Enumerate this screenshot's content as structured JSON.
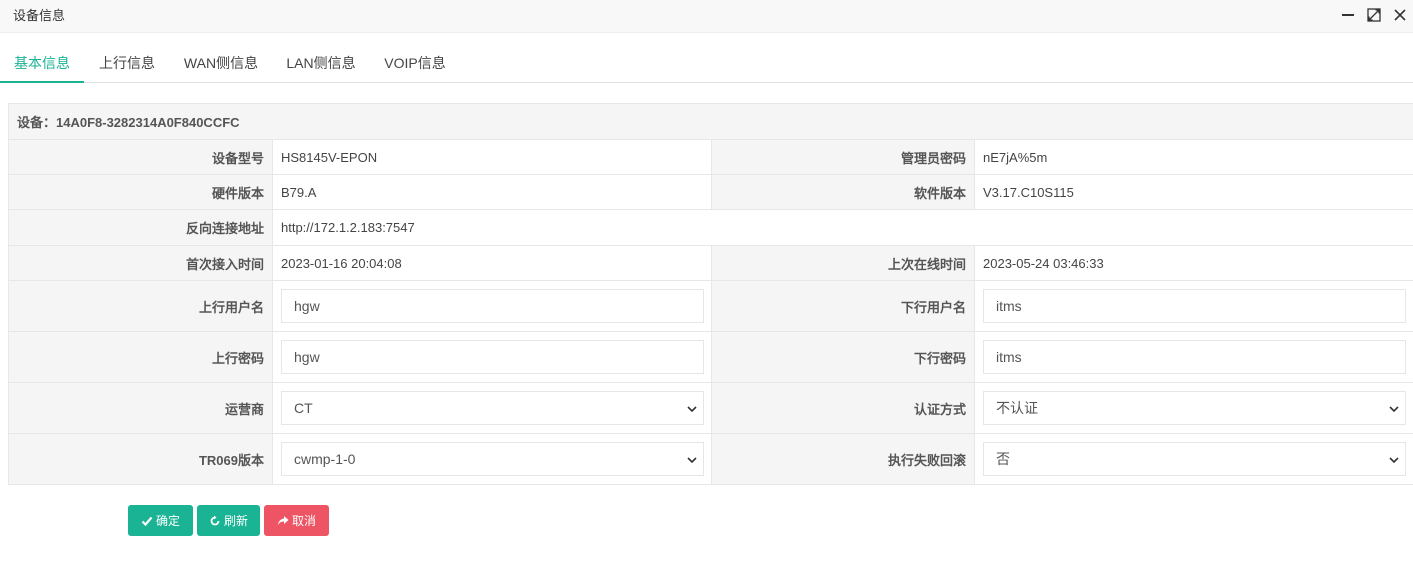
{
  "window": {
    "title": "设备信息"
  },
  "tabs": [
    {
      "label": "基本信息",
      "active": true
    },
    {
      "label": "上行信息"
    },
    {
      "label": "WAN侧信息"
    },
    {
      "label": "LAN侧信息"
    },
    {
      "label": "VOIP信息"
    }
  ],
  "device": {
    "header": "设备：14A0F8-3282314A0F840CCFC"
  },
  "fields": {
    "model_label": "设备型号",
    "model_value": "HS8145V-EPON",
    "admin_pwd_label": "管理员密码",
    "admin_pwd_value": "nE7jA%5m",
    "hw_label": "硬件版本",
    "hw_value": "B79.A",
    "sw_label": "软件版本",
    "sw_value": "V3.17.C10S115",
    "conn_url_label": "反向连接地址",
    "conn_url_value": "http://172.1.2.183:7547",
    "first_access_label": "首次接入时间",
    "first_access_value": "2023-01-16 20:04:08",
    "last_online_label": "上次在线时间",
    "last_online_value": "2023-05-24 03:46:33",
    "up_user_label": "上行用户名",
    "up_user_value": "hgw",
    "down_user_label": "下行用户名",
    "down_user_value": "itms",
    "up_pwd_label": "上行密码",
    "up_pwd_value": "hgw",
    "down_pwd_label": "下行密码",
    "down_pwd_value": "itms",
    "carrier_label": "运营商",
    "carrier_value": "CT",
    "auth_label": "认证方式",
    "auth_value": "不认证",
    "tr069_label": "TR069版本",
    "tr069_value": "cwmp-1-0",
    "rollback_label": "执行失败回滚",
    "rollback_value": "否"
  },
  "buttons": {
    "confirm": "确定",
    "refresh": "刷新",
    "cancel": "取消"
  },
  "colors": {
    "primary": "#1ab394",
    "danger": "#ed5565"
  },
  "icons": {
    "minimize": "minimize-icon",
    "maximize": "maximize-icon",
    "close": "close-icon",
    "confirm": "check-icon",
    "refresh": "refresh-icon",
    "cancel": "share-icon",
    "select": "chevron-down-icon"
  }
}
